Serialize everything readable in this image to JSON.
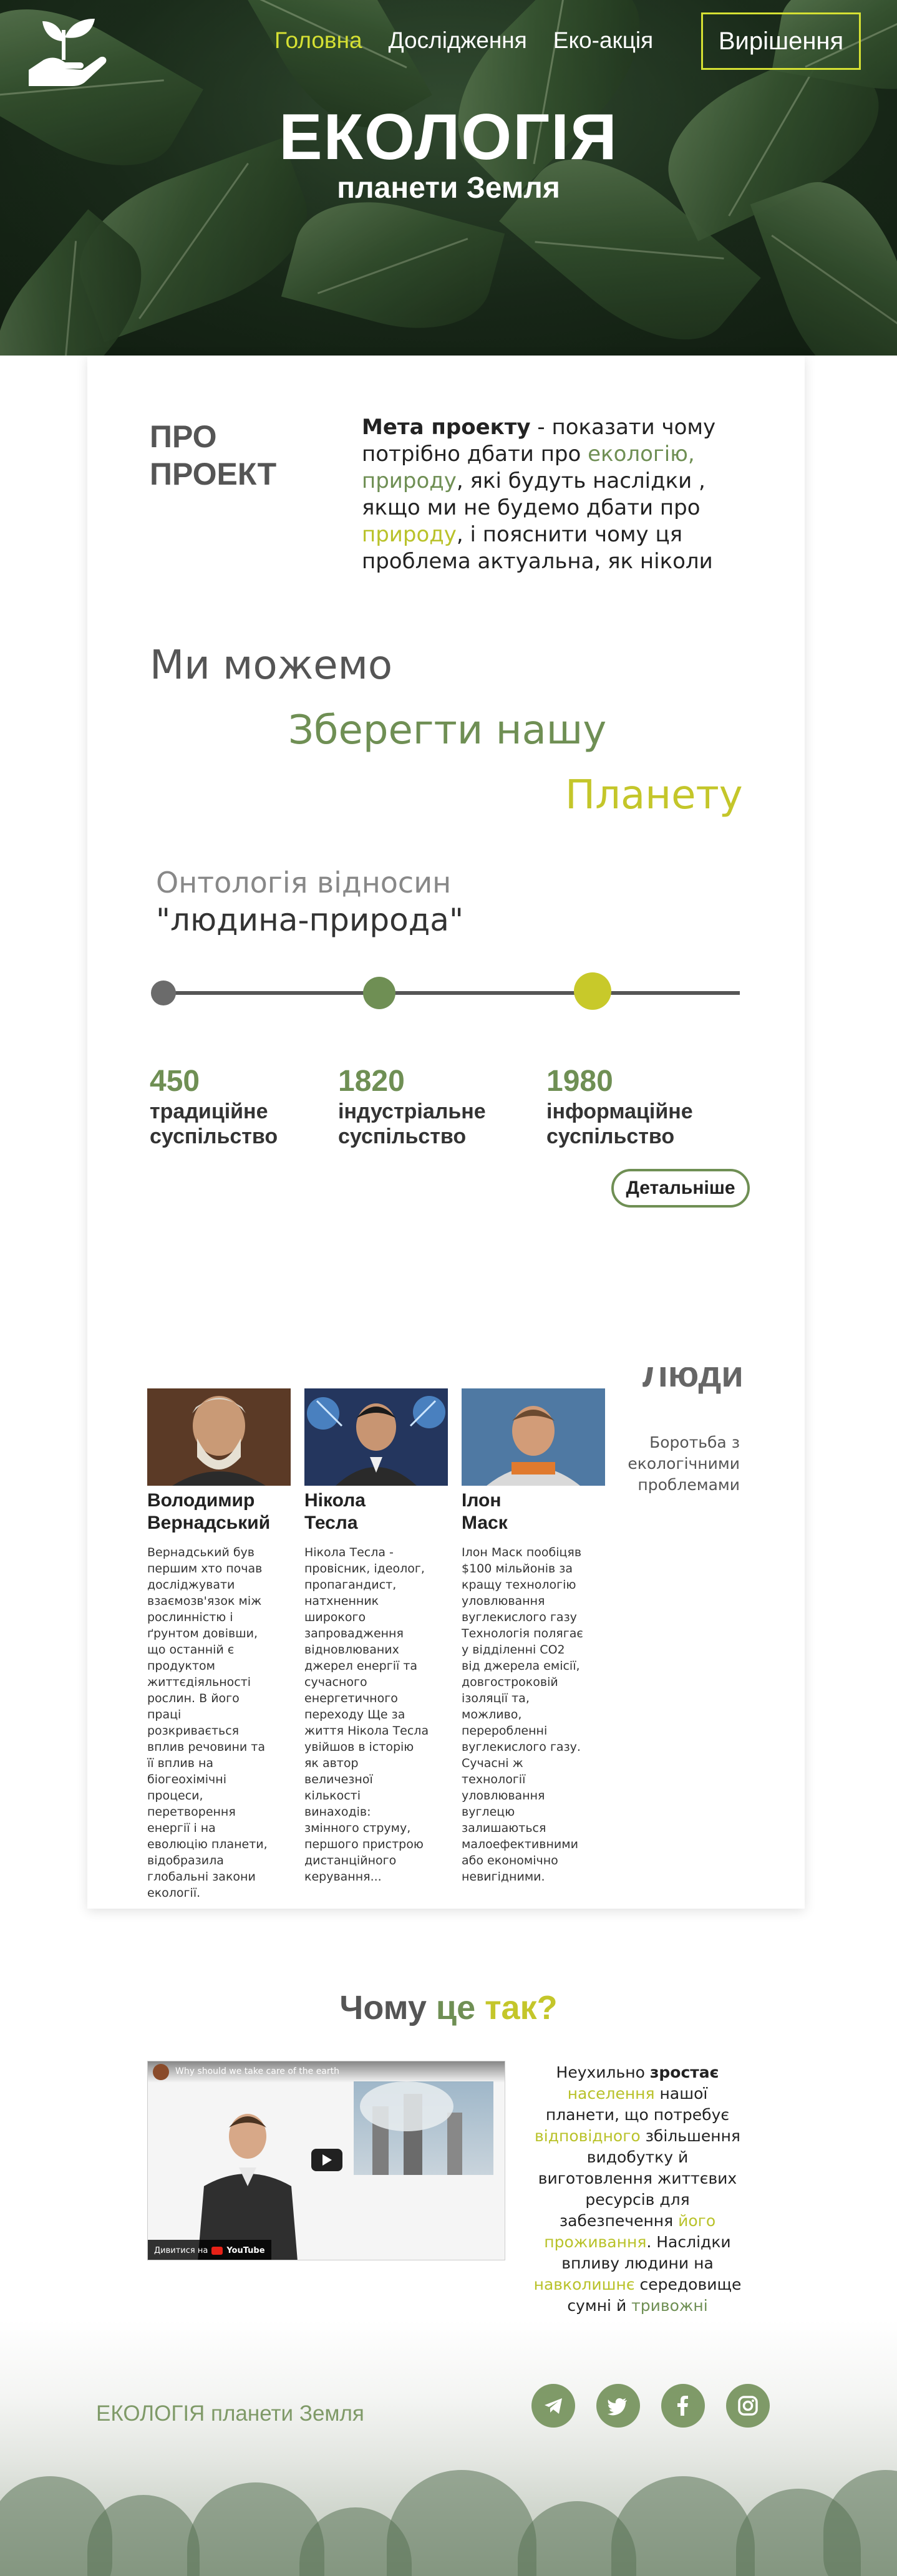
{
  "nav": {
    "items": [
      {
        "label": "Головна",
        "active": true
      },
      {
        "label": "Дослідження",
        "active": false
      },
      {
        "label": "Еко-акція",
        "active": false
      }
    ],
    "cta_label": "Вирішення",
    "logo_icon": "hand-with-sprout-icon"
  },
  "hero": {
    "title": "ЕКОЛОГІЯ",
    "subtitle": "планети Земля"
  },
  "about": {
    "heading_line1": "ПРО",
    "heading_line2": "ПРОЕКТ",
    "bold": "Мета проекту",
    "t1": " - показати чому потрібно дбати про ",
    "link1": "екологію, природу",
    "t2": ", які будуть наслідки , якщо ми не будемо дбати про ",
    "link2": "природу",
    "t3": ", і пояснити чому ця проблема актуальна, як ніколи"
  },
  "slogan": {
    "line1": "Ми можемо",
    "line2": "Зберегти нашу",
    "line3": "Планету"
  },
  "ontology": {
    "line1": "Онтологія відносин",
    "line2": "\"людина-природа\""
  },
  "timeline": [
    {
      "year": "450",
      "label1": "традиційне",
      "label2": "суспільство",
      "color": "#6b6b6b"
    },
    {
      "year": "1820",
      "label1": "індустріальне",
      "label2": "суспільство",
      "color": "#6f8f54"
    },
    {
      "year": "1980",
      "label1": "інформаційне",
      "label2": "суспільство",
      "color": "#c8c92a"
    }
  ],
  "more_label": "Детальніше",
  "people": {
    "heading": "Люди",
    "subtitle": "Боротьба з екологічними проблемами",
    "list": [
      {
        "name1": "Володимир",
        "name2": "Вернадський",
        "bio": "Вернадський був першим хто почав досліджувати взаємозв'язок між рослинністю і ґрунтом довівши, що останній є продуктом життєдіяльності рослин. В його праці розкривається вплив речовини та її вплив на біогеохімічні процеси, перетворення енергії і на еволюцію планети, відобразила глобальні закони екології."
      },
      {
        "name1": "Нікола",
        "name2": "Тесла",
        "bio": "Нікола Тесла - провісник, ідеолог, пропагандист, натхненник широкого запровадження відновлюваних джерел енергії та сучасного енергетичного переходу Ще за життя Нікола Тесла увійшов в історію як автор величезної кількості винаходів: змінного струму, першого пристрою дистанційного керування..."
      },
      {
        "name1": "Ілон",
        "name2": "Маск",
        "bio": "Ілон Маск пообіцяв $100 мільйонів за кращу технологію уловлювання вуглекислого газу Технологія полягає у відділенні CO2 від джерела емісії, довгостроковій ізоляції та, можливо, переробленні вуглекислого газу. Сучасні ж технології уловлювання вуглецю залишаються малоефективними або економічно невигідними."
      }
    ]
  },
  "why": {
    "w1": "Чому ",
    "w2": "це ",
    "w3": "так?",
    "video_title": "Why should we take care of the earth",
    "video_watch": "Дивитися на",
    "video_brand": "YouTube",
    "p": [
      {
        "t": "Неухильно ",
        "c": ""
      },
      {
        "t": "зростає",
        "c": "b"
      },
      {
        "t": " ",
        "c": ""
      },
      {
        "t": "населення",
        "c": "yg"
      },
      {
        "t": " нашої планети, що потребує ",
        "c": ""
      },
      {
        "t": "відповідного",
        "c": "yg"
      },
      {
        "t": " збільшення видобутку й виготовлення життєвих ресурсів для забезпечення ",
        "c": ""
      },
      {
        "t": "його проживання",
        "c": "yg"
      },
      {
        "t": ". Наслідки впливу людини на ",
        "c": ""
      },
      {
        "t": "навколишнє",
        "c": "yg"
      },
      {
        "t": " середовище сумні й ",
        "c": ""
      },
      {
        "t": "тривожні",
        "c": "green"
      }
    ]
  },
  "footer": {
    "brand": "ЕКОЛОГІЯ планети Земля",
    "socials": [
      "telegram-icon",
      "twitter-icon",
      "facebook-icon",
      "instagram-icon"
    ]
  },
  "colors": {
    "accent_green": "#6f8f54",
    "accent_yellow": "#c8c92a",
    "nav_active": "#d5e033"
  }
}
